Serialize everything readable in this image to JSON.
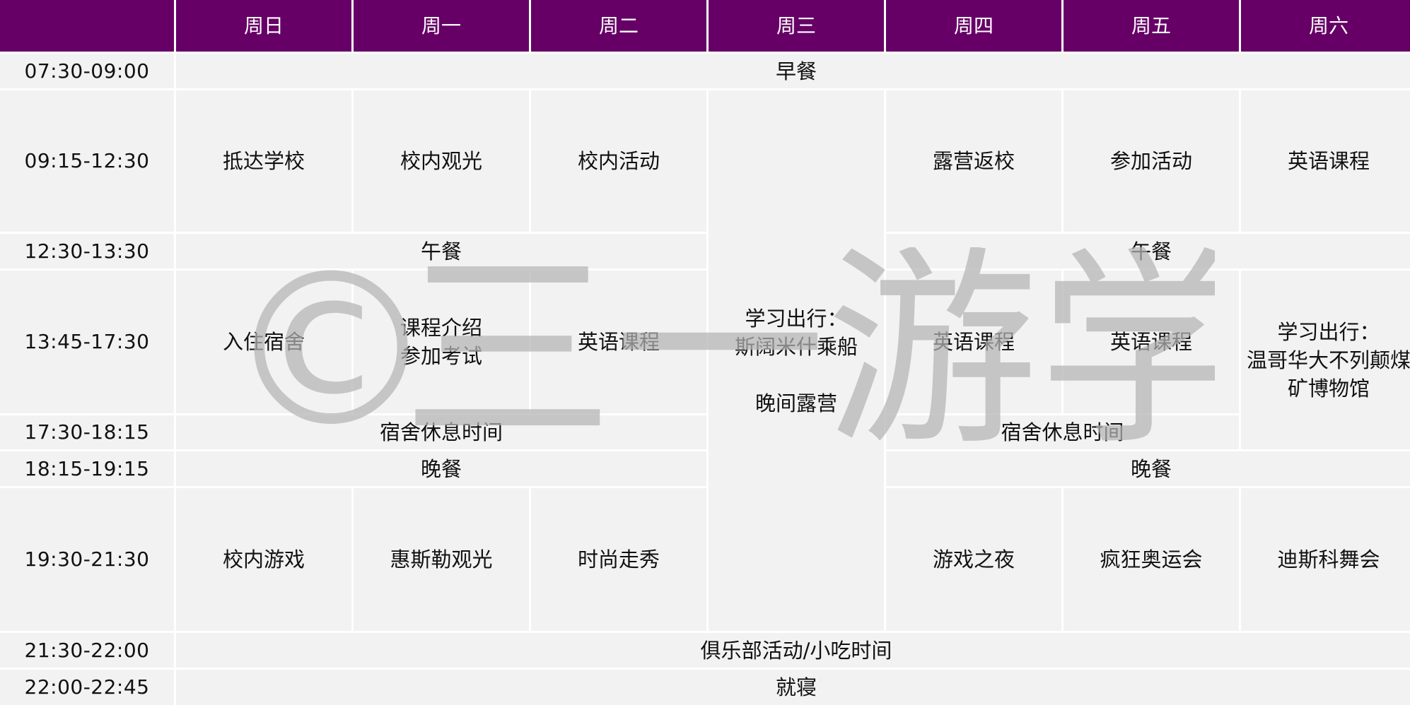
{
  "days": [
    "周日",
    "周一",
    "周二",
    "周三",
    "周四",
    "周五",
    "周六"
  ],
  "times": [
    "07:30-09:00",
    "09:15-12:30",
    "12:30-13:30",
    "13:45-17:30",
    "17:30-18:15",
    "18:15-19:15",
    "19:30-21:30",
    "21:30-22:00",
    "22:00-22:45"
  ],
  "rows": {
    "breakfast": "早餐",
    "morning": {
      "sun": "抵达学校",
      "mon": "校内观光",
      "tue": "校内活动",
      "thu": "露营返校",
      "fri": "参加活动",
      "sat": "英语课程"
    },
    "wednesday_trip": [
      "学习出行：",
      "斯阔米什乘船",
      "晚间露营"
    ],
    "lunch_left": "午餐",
    "lunch_right": "午餐",
    "afternoon": {
      "sun": "入住宿舍",
      "mon": [
        "课程介绍",
        "参加考试"
      ],
      "tue": "英语课程",
      "thu": "英语课程",
      "fri": "英语课程"
    },
    "saturday_trip": [
      "学习出行：",
      "温哥华大不列颠煤",
      "矿博物馆"
    ],
    "rest_left": "宿舍休息时间",
    "rest_right": "宿舍休息时间",
    "dinner_left": "晚餐",
    "dinner_right": "晚餐",
    "evening": {
      "sun": "校内游戏",
      "mon": "惠斯勒观光",
      "tue": "时尚走秀",
      "thu": "游戏之夜",
      "fri": "疯狂奥运会",
      "sat": "迪斯科舞会"
    },
    "club": "俱乐部活动/小吃时间",
    "bedtime": "就寝"
  },
  "watermark": {
    "symbol": "©",
    "text": "三一游学"
  },
  "colors": {
    "header_bg": "#660066",
    "header_text": "#ffffff",
    "cell_bg": "#f2f2f2",
    "grid_line": "#ffffff",
    "watermark": "#b4b4b4"
  }
}
